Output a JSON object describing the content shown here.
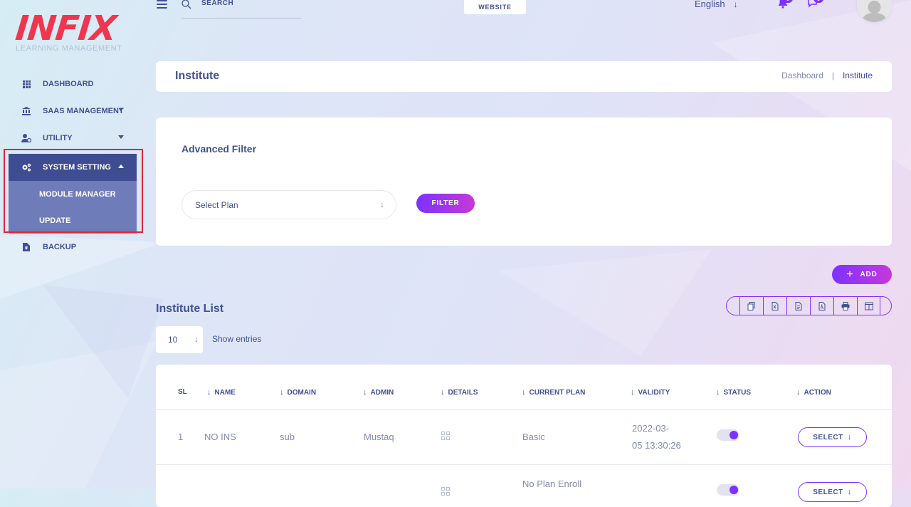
{
  "brand": {
    "logo_text": "INFIX",
    "logo_sub": "LEARNING MANAGEMENT"
  },
  "header": {
    "search_placeholder": "SEARCH",
    "website_label": "WEBSITE",
    "language": "English",
    "notification_count": "0",
    "message_count": "0"
  },
  "sidebar": {
    "items": [
      {
        "label": "DASHBOARD"
      },
      {
        "label": "SAAS MANAGEMENT"
      },
      {
        "label": "UTILITY"
      },
      {
        "label": "SYSTEM SETTING"
      },
      {
        "label": "BACKUP"
      }
    ],
    "submenu": [
      {
        "label": "MODULE MANAGER"
      },
      {
        "label": "UPDATE"
      }
    ]
  },
  "page": {
    "title": "Institute",
    "breadcrumb": [
      "Dashboard",
      "Institute"
    ],
    "breadcrumb_sep": "|"
  },
  "filter": {
    "title": "Advanced Filter",
    "select_placeholder": "Select Plan",
    "button": "FILTER"
  },
  "list": {
    "add_button": "ADD",
    "title": "Institute List",
    "entries_value": "10",
    "entries_label": "Show entries",
    "columns": [
      "SL",
      "NAME",
      "DOMAIN",
      "ADMIN",
      "DETAILS",
      "CURRENT PLAN",
      "VALIDITY",
      "STATUS",
      "ACTION"
    ],
    "rows": [
      {
        "sl": "1",
        "name": "NO INS",
        "domain": "sub",
        "admin": "Mustaq",
        "plan": "Basic",
        "validity_1": "2022-03-",
        "validity_2": "05 13:30:26",
        "status": true,
        "action": "SELECT"
      },
      {
        "sl": "",
        "name": "",
        "domain": "",
        "admin": "",
        "plan": "No Plan Enroll",
        "validity_1": "",
        "validity_2": "",
        "status": true,
        "action": "SELECT"
      }
    ]
  },
  "colors": {
    "accent": "#7c32ff",
    "primary_text": "#415094",
    "highlight": "#e1263b",
    "logo": "#f0364e"
  }
}
